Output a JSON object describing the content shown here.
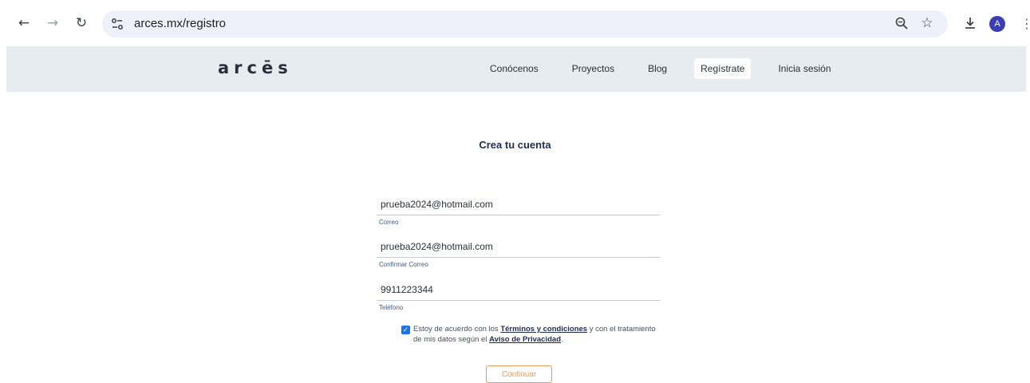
{
  "browser": {
    "url": "arces.mx/registro",
    "avatar_letter": "A",
    "icons": {
      "back": "arrow-left-icon",
      "forward": "arrow-right-icon",
      "reload": "reload-icon",
      "site_info": "tune-icon",
      "zoom": "zoom-icon",
      "bookmark": "star-icon",
      "download": "download-icon",
      "menu": "kebab-menu-icon"
    },
    "accent_color": "#3b3fb6"
  },
  "header": {
    "logo": "arcēs",
    "nav": [
      {
        "label": "Conócenos"
      },
      {
        "label": "Proyectos"
      },
      {
        "label": "Blog"
      },
      {
        "label": "Regístrate",
        "active": true
      },
      {
        "label": "Inicia sesión"
      }
    ],
    "background_color": "#e7ecf1"
  },
  "form": {
    "title": "Crea tu cuenta",
    "fields": [
      {
        "value": "prueba2024@hotmail.com",
        "label": "Correo"
      },
      {
        "value": "prueba2024@hotmail.com",
        "label": "Confirmar Correo"
      },
      {
        "value": "9911223344",
        "label": "Teléfono"
      }
    ],
    "consent": {
      "checked": true,
      "text_1": "Estoy de acuerdo con los ",
      "terms_link": "Términos y condiciones",
      "text_2": " y con el tratamiento de mis datos según el ",
      "privacy_link": "Aviso de Privacidad",
      "text_3": "."
    },
    "continue_label": "Continuar",
    "button_color": "#e89a5c"
  }
}
